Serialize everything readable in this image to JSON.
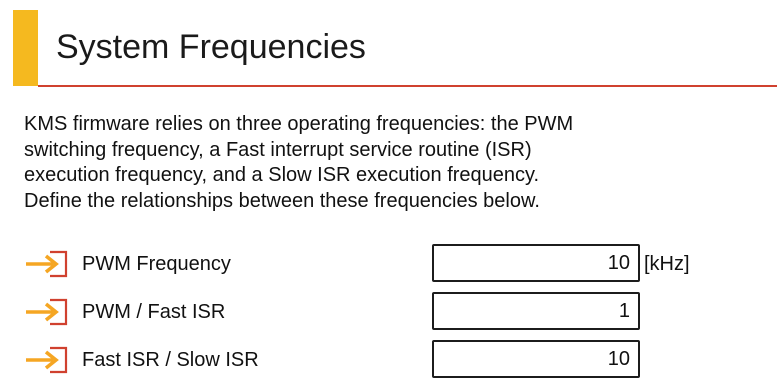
{
  "header": {
    "title": "System Frequencies",
    "accent_color": "#f5b91f",
    "rule_color": "#d0412f"
  },
  "description": {
    "lines": [
      "KMS firmware relies on three operating frequencies: the PWM",
      "switching frequency, a Fast interrupt service routine (ISR)",
      "execution frequency, and a Slow ISR execution frequency.",
      "Define the relationships between these frequencies below."
    ]
  },
  "parameters": [
    {
      "label": "PWM Frequency",
      "value": "10",
      "unit": "[kHz]",
      "icon": "input-arrow-icon"
    },
    {
      "label": "PWM / Fast ISR",
      "value": "1",
      "unit": "",
      "icon": "input-arrow-icon"
    },
    {
      "label": "Fast ISR / Slow ISR",
      "value": "10",
      "unit": "",
      "icon": "input-arrow-icon"
    }
  ],
  "icon_colors": {
    "arrow": "#f5a623",
    "bracket": "#d0412f"
  }
}
